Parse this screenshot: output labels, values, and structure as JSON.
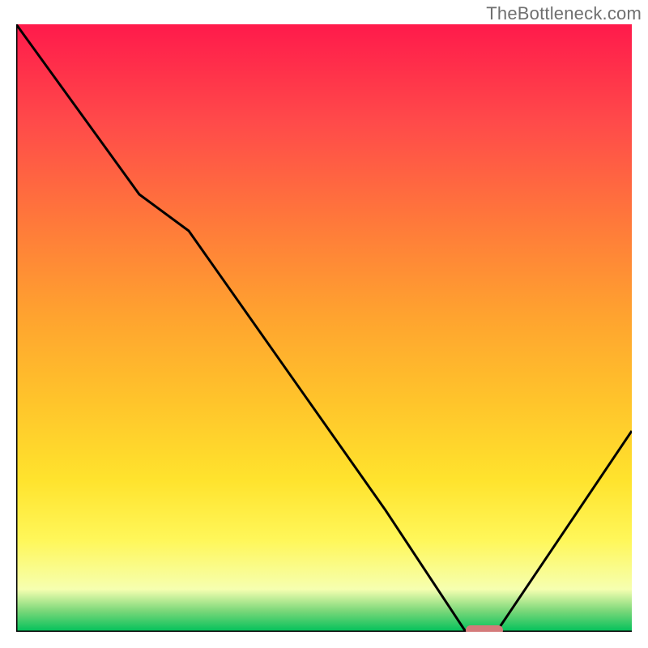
{
  "watermark": "TheBottleneck.com",
  "colors": {
    "gradient_top": "#ff1a4b",
    "gradient_bottom": "#00c05a",
    "curve": "#000000",
    "marker": "#d47a7a"
  },
  "chart_data": {
    "type": "line",
    "title": "",
    "xlabel": "",
    "ylabel": "",
    "xlim": [
      0,
      100
    ],
    "ylim": [
      0,
      100
    ],
    "grid": false,
    "background": "vertical red→yellow→green gradient (bottleneck severity scale, 100=worst at top, 0=best at bottom)",
    "series": [
      {
        "name": "bottleneck-curve",
        "x": [
          0,
          20,
          28,
          60,
          73,
          78,
          100
        ],
        "values": [
          100,
          72,
          66,
          20,
          0,
          0,
          33
        ]
      }
    ],
    "marker": {
      "name": "optimal-range",
      "x": 76,
      "y": 0,
      "width": 6
    }
  }
}
